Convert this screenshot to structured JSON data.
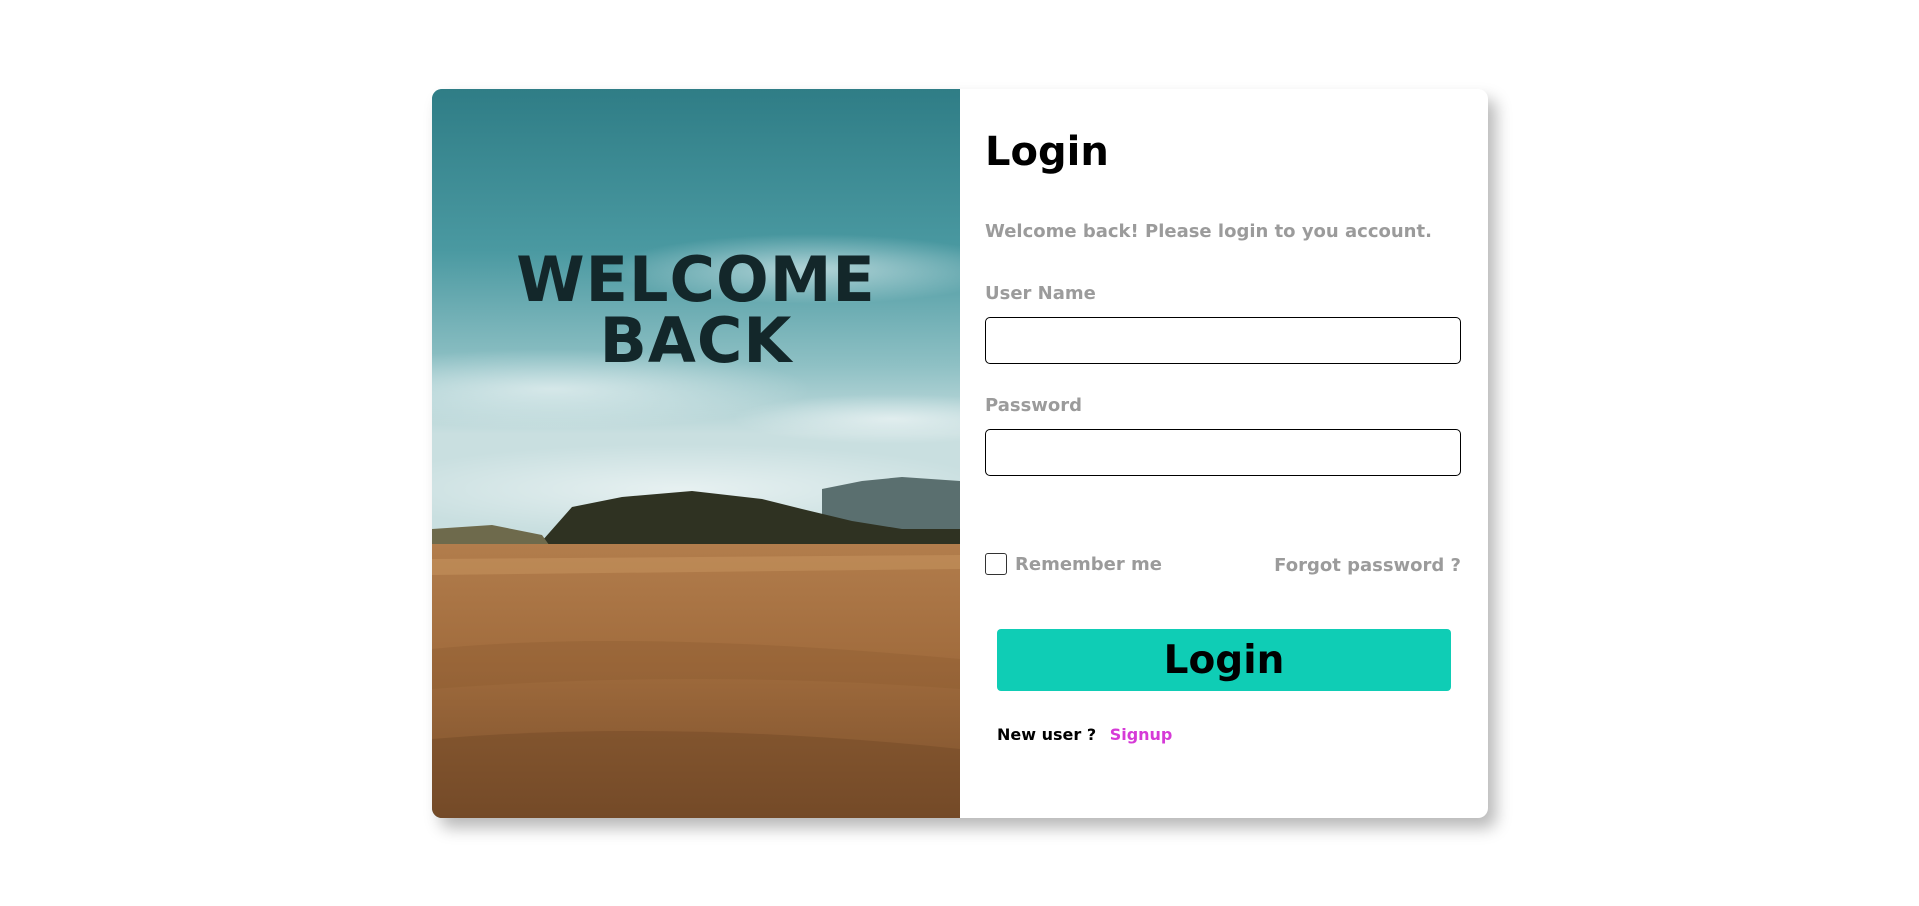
{
  "colors": {
    "accent": "#0fcdb5",
    "link": "#d63ad7",
    "muted_text": "#9b9b9b",
    "hero_text": "#13272a"
  },
  "hero": {
    "line1": "WELCOME",
    "line2": "BACK",
    "image": "landscape-sky-grassland"
  },
  "form": {
    "title": "Login",
    "subtitle": "Welcome back! Please login to you account.",
    "username_label": "User Name",
    "username_value": "",
    "password_label": "Password",
    "password_value": "",
    "remember_label": "Remember me",
    "remember_checked": false,
    "forgot_label": "Forgot password ?",
    "submit_label": "Login",
    "new_user_text": "New user ?",
    "signup_label": "Signup"
  }
}
